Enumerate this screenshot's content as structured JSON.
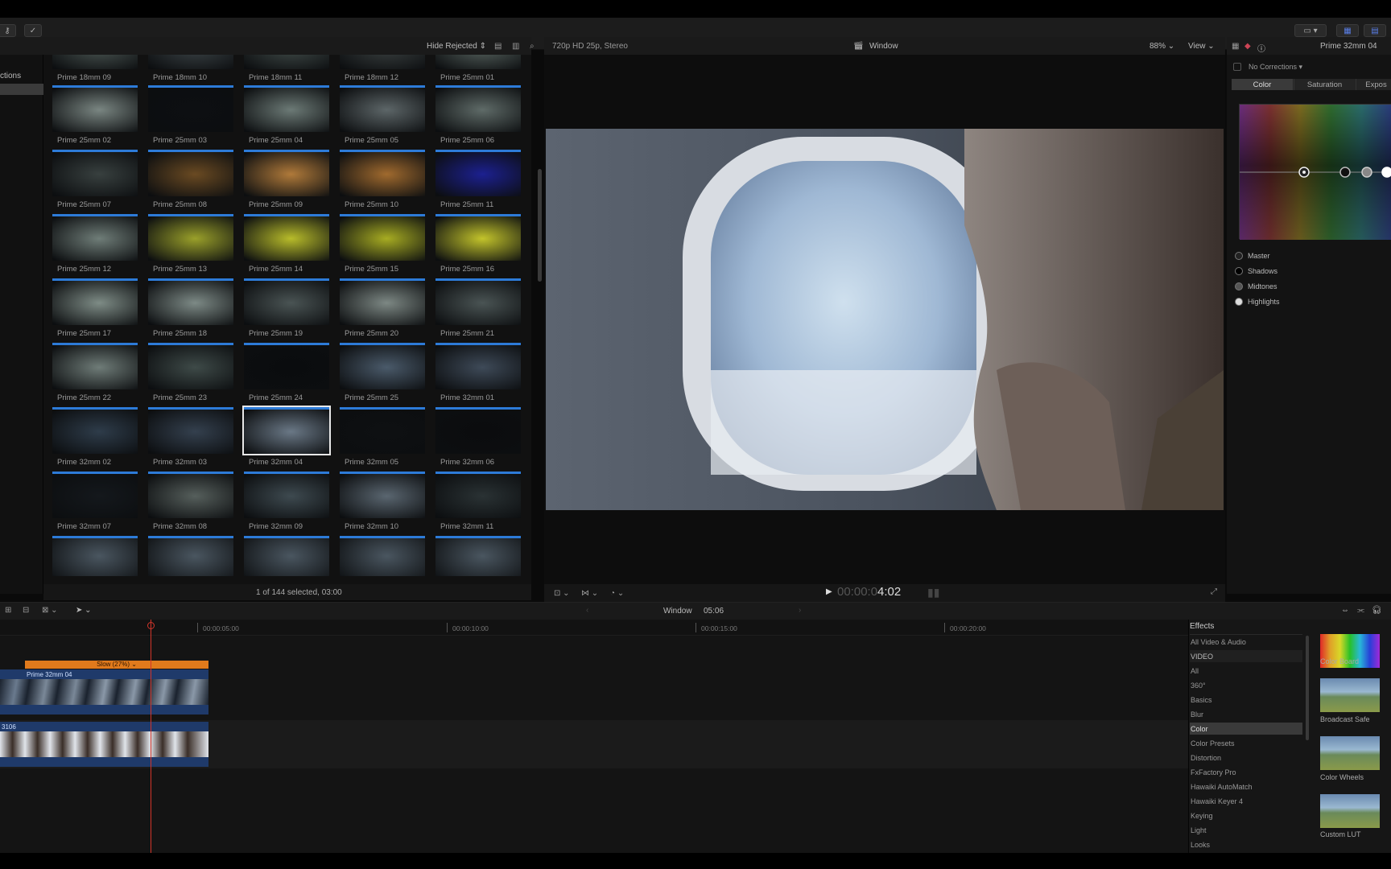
{
  "browser": {
    "filter_label": "Hide Rejected",
    "sidebar_label": "ctions",
    "status": "1 of 144 selected, 03:00",
    "clips": [
      "Prime 18mm 09",
      "Prime 18mm 10",
      "Prime 18mm 11",
      "Prime 18mm 12",
      "Prime 25mm 01",
      "Prime 25mm 02",
      "Prime 25mm 03",
      "Prime 25mm 04",
      "Prime 25mm 05",
      "Prime 25mm 06",
      "Prime 25mm 07",
      "Prime 25mm 08",
      "Prime 25mm 09",
      "Prime 25mm 10",
      "Prime 25mm 11",
      "Prime 25mm 12",
      "Prime 25mm 13",
      "Prime 25mm 14",
      "Prime 25mm 15",
      "Prime 25mm 16",
      "Prime 25mm 17",
      "Prime 25mm 18",
      "Prime 25mm 19",
      "Prime 25mm 20",
      "Prime 25mm 21",
      "Prime 25mm 22",
      "Prime 25mm 23",
      "Prime 25mm 24",
      "Prime 25mm 25",
      "Prime 32mm 01",
      "Prime 32mm 02",
      "Prime 32mm 03",
      "Prime 32mm 04",
      "Prime 32mm 05",
      "Prime 32mm 06",
      "Prime 32mm 07",
      "Prime 32mm 08",
      "Prime 32mm 09",
      "Prime 32mm 10",
      "Prime 32mm 11"
    ],
    "selected_clip": "Prime 32mm 04",
    "thumb_colors": [
      "#4a5552",
      "#3b4346",
      "#404a48",
      "#3a4040",
      "#56625e",
      "#7a8682",
      "#0d0f12",
      "#6c7a76",
      "#5d6668",
      "#5f6b68",
      "#38403f",
      "#6a4a22",
      "#b07a3a",
      "#a06a2e",
      "#1c2090",
      "#6f7d78",
      "#9aa02a",
      "#b8bc2a",
      "#a7ac22",
      "#c3c42b",
      "#7e8c86",
      "#7d8a86",
      "#4a5454",
      "#7d8884",
      "#4a5454",
      "#6f7c78",
      "#3e4a48",
      "#0a0c0e",
      "#4a5a6a",
      "#3e4a58",
      "#2e3c4a",
      "#34404e",
      "#6a7886",
      "#0e1012",
      "#0b0c0e",
      "#14181c",
      "#565f5c",
      "#3e4a50",
      "#5a6670",
      "#2a3234"
    ]
  },
  "viewer": {
    "format": "720p HD 25p, Stereo",
    "title": "Window",
    "zoom": "88%",
    "view_menu": "View",
    "timecode_dim": "00:00:0",
    "timecode_bright": "4:02"
  },
  "inspector": {
    "clip_name": "Prime 32mm 04",
    "corrections": "No Corrections",
    "tabs": [
      "Color",
      "Saturation",
      "Expos"
    ],
    "ranges": [
      "Master",
      "Shadows",
      "Midtones",
      "Highlights"
    ]
  },
  "timeline": {
    "title": "Window",
    "duration": "05:06",
    "ticks": [
      "00:00:05:00",
      "00:00:10:00",
      "00:00:15:00",
      "00:00:20:00"
    ],
    "retime_label": "Slow (27%)",
    "connected_clip": "Prime 32mm 04",
    "primary_clip": "3106"
  },
  "effects": {
    "header": "Effects",
    "categories": [
      "All Video & Audio",
      "VIDEO",
      "All",
      "360°",
      "Basics",
      "Blur",
      "Color",
      "Color Presets",
      "Distortion",
      "FxFactory Pro",
      "Hawaiki AutoMatch",
      "Hawaiki Keyer 4",
      "Keying",
      "Light",
      "Looks"
    ],
    "selected_category": "Color",
    "items": [
      "Color Board",
      "Broadcast Safe",
      "Color Wheels",
      "Custom LUT"
    ]
  },
  "colors": {
    "accent_blue": "#2d7bd8",
    "playhead_red": "#d2352a",
    "retime_orange": "#e07a1c"
  }
}
